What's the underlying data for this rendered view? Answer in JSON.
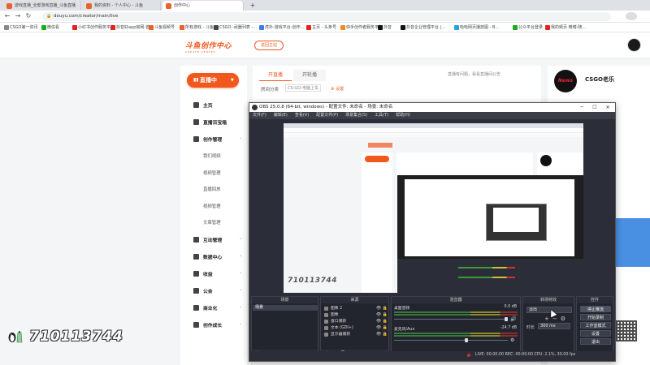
{
  "browser": {
    "tabs": [
      {
        "label": "游戏直播_全部游戏直播_斗鱼直播",
        "color": "#f08a24"
      },
      {
        "label": "我的资料 - 个人中心 - 斗鱼",
        "color": "#f08a24"
      },
      {
        "label": "创作中心",
        "color": "#f08a24"
      }
    ],
    "new_tab": "+",
    "url": "douyu.com/creator/main/live"
  },
  "bookmarks": [
    {
      "label": "CSGO第一资讯",
      "color": "#888888"
    },
    {
      "label": "微信看",
      "color": "#1aad19"
    },
    {
      "label": "小红书创作服务平台",
      "color": "#e2231a"
    },
    {
      "label": "抖音好app官网-首...",
      "color": "#e2231a"
    },
    {
      "label": "斗鱼视频号",
      "color": "#e8622b"
    },
    {
      "label": "所有游戏 - 斗鱼",
      "color": "#e8622b"
    },
    {
      "label": "CSGO -武器列表 -...",
      "color": "#444444"
    },
    {
      "label": "虎扑-游戏平台-创作...",
      "color": "#3b7de0"
    },
    {
      "label": "主页 - 头条号",
      "color": "#e2231a"
    },
    {
      "label": "快手创作者服务平台",
      "color": "#f08a24"
    },
    {
      "label": "抖音",
      "color": "#111111"
    },
    {
      "label": "抖音企业管理平台 |...",
      "color": "#111111"
    },
    {
      "label": "哈哈网页播放图 - B...",
      "color": "#2aa0de"
    },
    {
      "label": "公众平台登录",
      "color": "#1aad19"
    },
    {
      "label": "我的频页 微博-随...",
      "color": "#e2231a"
    }
  ],
  "site": {
    "logo_title": "斗鱼创作中心",
    "logo_sub": "CREATE CENTER",
    "back_label": "返回主站"
  },
  "sidebar": {
    "live_button": "直播中",
    "items": [
      {
        "label": "主页",
        "kind": "main"
      },
      {
        "label": "直播百宝箱",
        "kind": "main"
      },
      {
        "label": "创作管理",
        "kind": "main",
        "chevron": true
      },
      {
        "label": "我们视频",
        "kind": "sub"
      },
      {
        "label": "视频管理",
        "kind": "sub"
      },
      {
        "label": "直播回放",
        "kind": "sub"
      },
      {
        "label": "视频管理",
        "kind": "sub"
      },
      {
        "label": "文章管理",
        "kind": "sub"
      },
      {
        "label": "互动管理",
        "kind": "main",
        "chevron": true
      },
      {
        "label": "数据中心",
        "kind": "main",
        "chevron": true
      },
      {
        "label": "收益",
        "kind": "main",
        "chevron": true
      },
      {
        "label": "公会",
        "kind": "main",
        "chevron": true
      },
      {
        "label": "商业化",
        "kind": "main",
        "chevron": true
      },
      {
        "label": "创作成长",
        "kind": "main",
        "chevron": true
      }
    ]
  },
  "main": {
    "tab_live": "开直播",
    "tab_video": "开轮播",
    "notice": "直播有问题，看看直播间公告",
    "room_label": "房间分类",
    "room_value": "CS:GO-电脑上车",
    "room_set": "设置"
  },
  "rightpanel": {
    "avatar_text": "News",
    "name": "CSGO老乐"
  },
  "obs": {
    "title": "OBS 25.0.8 (64-bit, windows) - 配置文件: 未命名 - 场景: 未命名",
    "menu": [
      "文件(F)",
      "编辑(E)",
      "查看(V)",
      "配置文件(P)",
      "场景集合(S)",
      "工具(T)",
      "帮助(H)"
    ],
    "docks": {
      "scenes": "场景",
      "sources": "来源",
      "mixer": "混音器",
      "transitions": "转场特效",
      "controls": "控件"
    },
    "scene_items": [
      "场景"
    ],
    "sources": [
      {
        "label": "图像 2"
      },
      {
        "label": "图像"
      },
      {
        "label": "窗口捕获"
      },
      {
        "label": "文本 (GDI+)"
      },
      {
        "label": "显示器捕获"
      }
    ],
    "mixer": [
      {
        "label": "桌面音频",
        "value": "0.0 dB"
      },
      {
        "label": "麦克风/Aux",
        "value": "-24.7 dB"
      }
    ],
    "transition": {
      "type": "淡出",
      "duration_label": "时长",
      "duration": "300 ms"
    },
    "controls": [
      "停止推流",
      "开始录制",
      "工作室模式",
      "设置",
      "退出"
    ],
    "status": "LIVE: 00:00:00   REC: 00:00:00   CPU: 2.1%, 30.00 fps"
  },
  "watermark": {
    "text": "710113744"
  }
}
